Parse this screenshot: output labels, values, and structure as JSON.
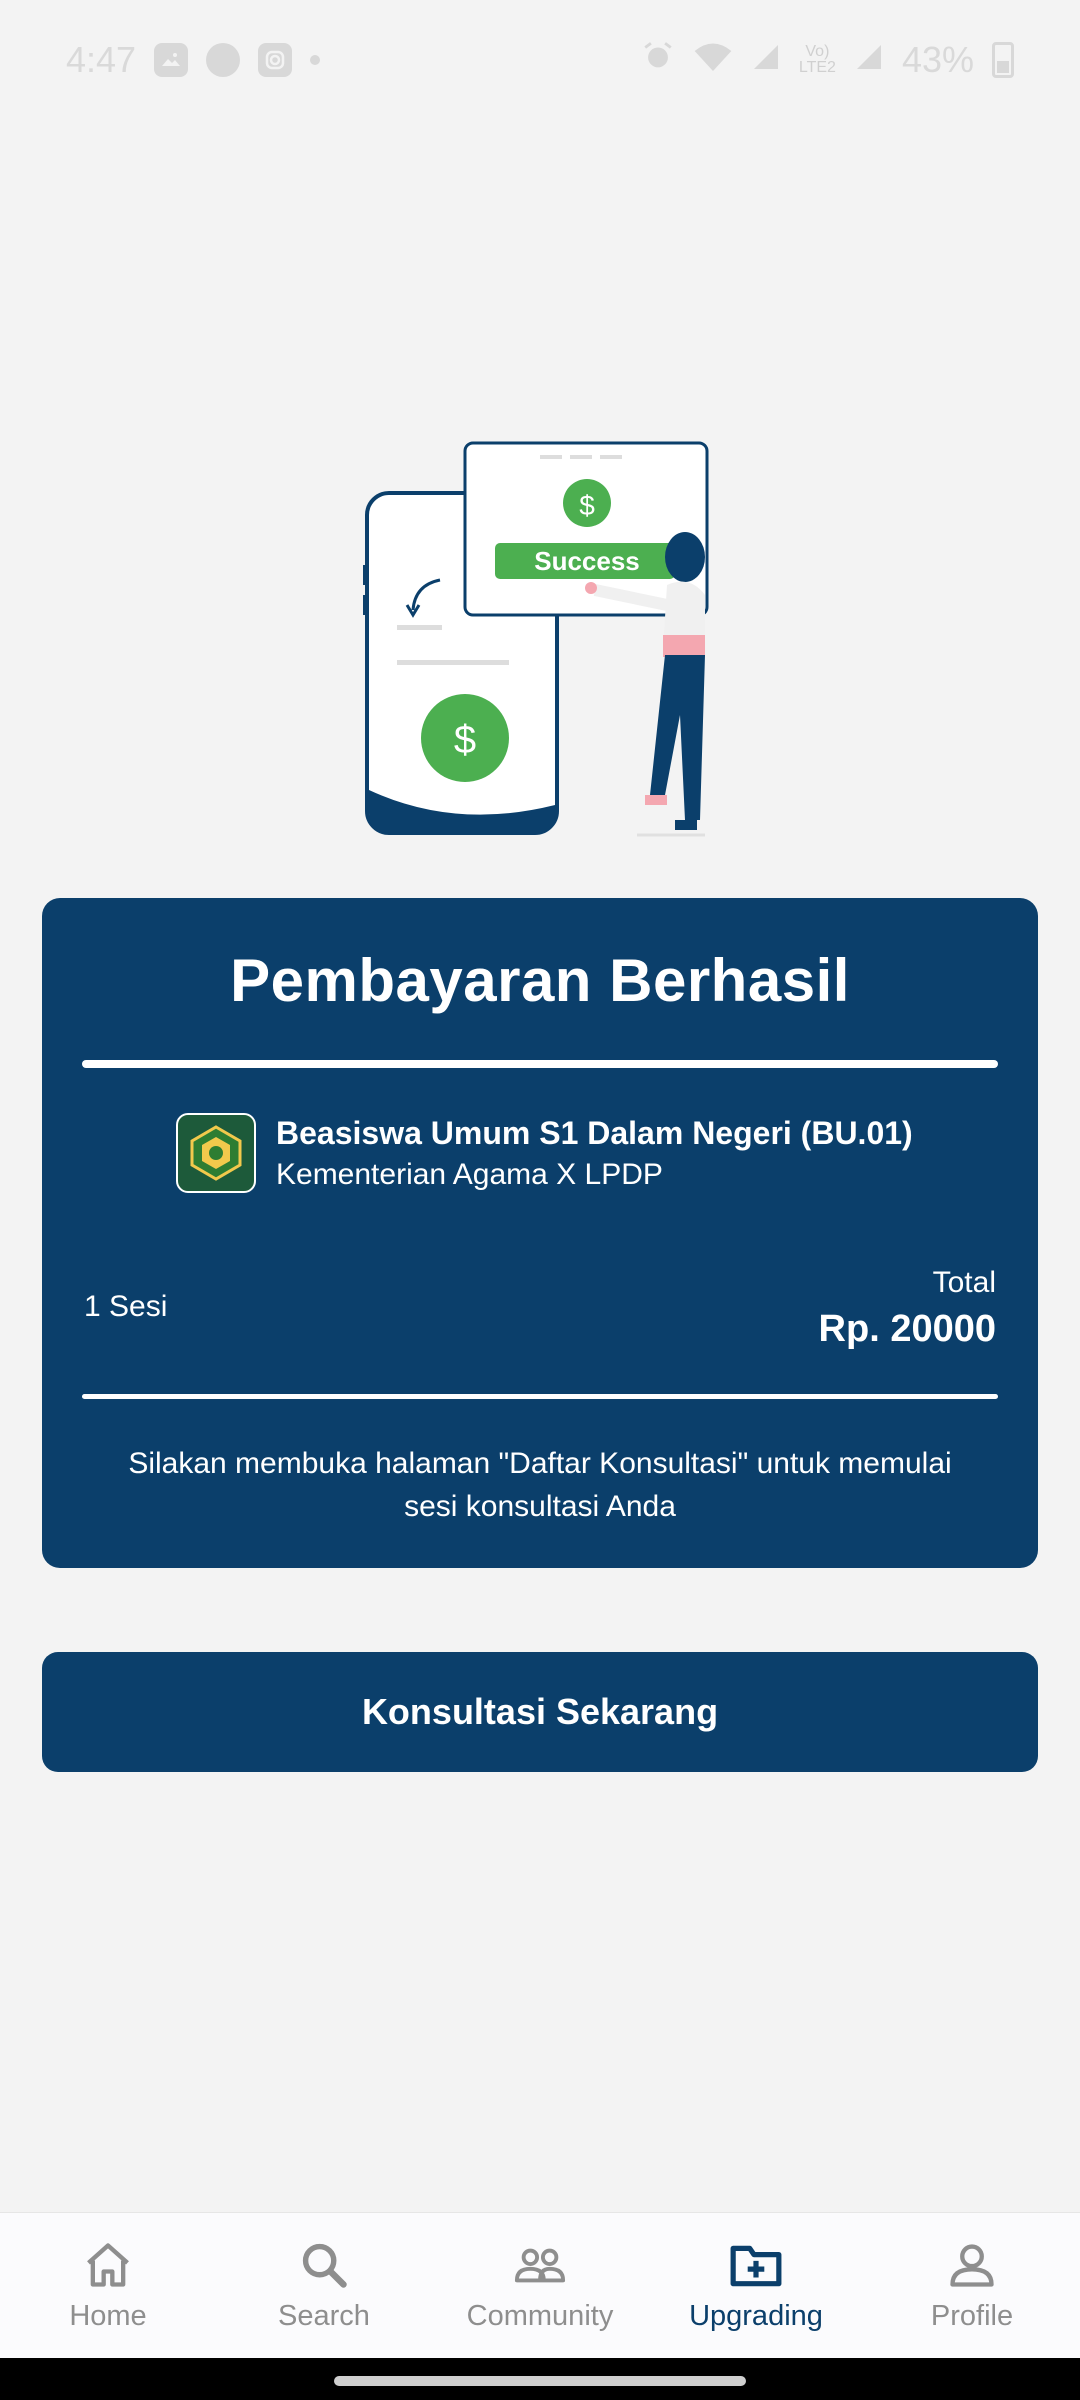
{
  "status_bar": {
    "time": "4:47",
    "network_label_top": "Vo)",
    "network_label_bottom": "LTE2",
    "battery": "43%"
  },
  "illustration": {
    "success_label": "Success",
    "dollar_sign": "$"
  },
  "card": {
    "title": "Pembayaran Berhasil",
    "scholarship_name": "Beasiswa Umum S1 Dalam Negeri (BU.01)",
    "scholarship_provider": "Kementerian Agama X LPDP",
    "sessions": "1 Sesi",
    "total_label": "Total",
    "total_value": "Rp. 20000",
    "note": "Silakan membuka halaman \"Daftar Konsultasi\" untuk memulai sesi konsultasi Anda"
  },
  "cta": {
    "label": "Konsultasi Sekarang"
  },
  "nav": {
    "items": [
      {
        "label": "Home",
        "icon": "home-icon"
      },
      {
        "label": "Search",
        "icon": "search-icon"
      },
      {
        "label": "Community",
        "icon": "community-icon"
      },
      {
        "label": "Upgrading",
        "icon": "folder-add-icon",
        "active": true
      },
      {
        "label": "Profile",
        "icon": "profile-icon"
      }
    ]
  },
  "colors": {
    "primary": "#0b3f6b",
    "success_green": "#4caf50",
    "background": "#f3f3f3",
    "nav_inactive": "#8e8e8e"
  }
}
